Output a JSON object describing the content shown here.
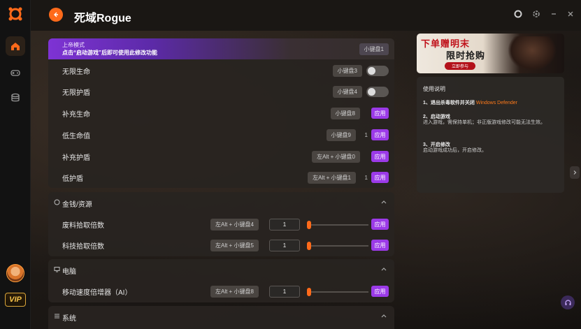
{
  "app": {
    "title": "死域Rogue"
  },
  "sidebar": {
    "items": [
      {
        "icon": "home-icon"
      },
      {
        "icon": "gamepad-icon"
      },
      {
        "icon": "database-icon"
      }
    ],
    "vip_label": "VIP"
  },
  "window": {
    "icons": [
      "record-icon",
      "settings-icon",
      "minimize-icon",
      "close-icon"
    ]
  },
  "top_banner": {
    "mode_label": "上帝模式",
    "note": "点击“启动游戏”后即可使用此修改功能",
    "key": "小键盘1"
  },
  "godmode_rows": [
    {
      "label": "无限生命",
      "key": "小键盘3",
      "control": "toggle"
    },
    {
      "label": "无限护盾",
      "key": "小键盘4",
      "control": "toggle"
    },
    {
      "label": "补充生命",
      "key": "小键盘8",
      "control": "apply",
      "apply_label": "应用"
    },
    {
      "label": "低生命值",
      "key": "小键盘9",
      "count": "1",
      "control": "apply",
      "apply_label": "应用"
    },
    {
      "label": "补充护盾",
      "key": "左Alt + 小键盘0",
      "control": "apply",
      "apply_label": "应用"
    },
    {
      "label": "低护盾",
      "key": "左Alt + 小键盘1",
      "count": "1",
      "control": "apply",
      "apply_label": "应用"
    }
  ],
  "section_money": {
    "title": "金钱/资源",
    "rows": [
      {
        "label": "废料拾取倍数",
        "key": "左Alt + 小键盘4",
        "value": "1",
        "slider": 0,
        "apply_label": "应用"
      },
      {
        "label": "科技拾取倍数",
        "key": "左Alt + 小键盘5",
        "value": "1",
        "slider": 0,
        "apply_label": "应用"
      }
    ]
  },
  "section_pc": {
    "title": "电脑",
    "rows": [
      {
        "label": "移动速度倍增器（AI）",
        "key": "左Alt + 小键盘8",
        "value": "1",
        "slider": 0,
        "apply_label": "应用"
      }
    ]
  },
  "section_system": {
    "title": "系统"
  },
  "promo": {
    "line1": "下单赠明末",
    "line2": "限时抢购",
    "cta": "立即参与"
  },
  "guide": {
    "heading": "使用说明",
    "step1_prefix": "1、退出杀毒软件并关闭 ",
    "step1_highlight": "Windows Defender",
    "step2_title": "2、启动游戏",
    "step2_text": "进入游戏，需保持单机；非正版游戏修改可能无法生效。",
    "step3_title": "3、开启修改",
    "step3_text": "启动游戏成功后，开启修改。"
  },
  "colors": {
    "accent": "#ff6a1a",
    "apply": "#9b3ae8",
    "banner": "#7e33d4"
  }
}
